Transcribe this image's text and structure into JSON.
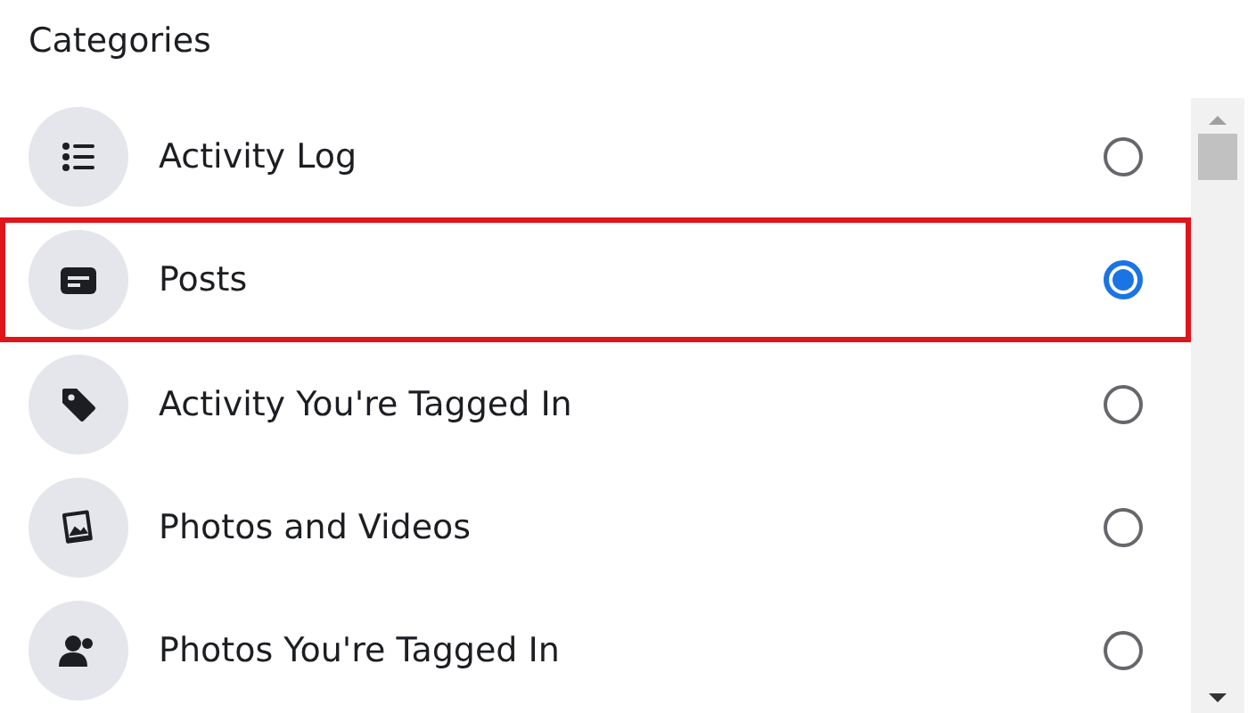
{
  "heading": "Categories",
  "items": [
    {
      "label": "Activity Log",
      "selected": false,
      "highlighted": false
    },
    {
      "label": "Posts",
      "selected": true,
      "highlighted": true
    },
    {
      "label": "Activity You're Tagged In",
      "selected": false,
      "highlighted": false
    },
    {
      "label": "Photos and Videos",
      "selected": false,
      "highlighted": false
    },
    {
      "label": "Photos You're Tagged In",
      "selected": false,
      "highlighted": false
    }
  ]
}
